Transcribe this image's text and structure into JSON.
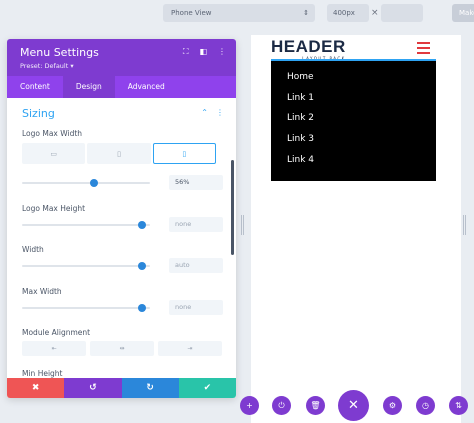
{
  "topbar": {
    "view_select": "Phone View",
    "select_arrows": "⇕",
    "width_value": "400px",
    "times": "×",
    "make_label": "Make"
  },
  "preview": {
    "logo_main": "HEADER",
    "logo_sub": "LAYOUT PACK",
    "menu_items": [
      "Home",
      "Link 1",
      "Link 2",
      "Link 3",
      "Link 4"
    ],
    "colors": {
      "hamburger": "#e0393e",
      "menu_bg": "#000000",
      "accent_line": "#2ea3f2"
    }
  },
  "panel": {
    "title": "Menu Settings",
    "preset": "Preset: Default ▾",
    "header_icons": [
      "expand-icon",
      "split-view-icon",
      "more-icon"
    ],
    "tabs": [
      "Content",
      "Design",
      "Advanced"
    ],
    "active_tab": "Design",
    "section_title": "Sizing",
    "section_icons": {
      "collapse": "⌃",
      "more": "⋮"
    },
    "fields": {
      "logo_max_width": {
        "label": "Logo Max Width",
        "value": "56%",
        "slider_fraction": 0.56
      },
      "logo_max_height": {
        "label": "Logo Max Height",
        "value": "none",
        "slider_fraction": 0.94
      },
      "width": {
        "label": "Width",
        "value": "auto",
        "slider_fraction": 0.94
      },
      "max_width": {
        "label": "Max Width",
        "value": "none",
        "slider_fraction": 0.94
      },
      "module_alignment": {
        "label": "Module Alignment",
        "options": [
          "⇤",
          "⇹",
          "⇥"
        ]
      },
      "min_height": {
        "label": "Min Height"
      }
    },
    "device_icons": {
      "desktop": "▭",
      "tablet": "▯",
      "phone": "▯"
    },
    "footer": {
      "cancel": "✖",
      "undo": "↺",
      "redo": "↻",
      "save": "✔"
    },
    "colors": {
      "header": "#7e3bd0",
      "tabs": "#8f42ec",
      "accent": "#2ea3f2",
      "cancel": "#ef5555",
      "undo": "#7e3bd0",
      "redo": "#2b87da",
      "save": "#29c4a9"
    }
  },
  "bottom_toolbar": {
    "add": "+",
    "power": "⏻",
    "trash": "🗑",
    "close": "✕",
    "settings": "⚙",
    "history": "◷",
    "sort": "⇅"
  }
}
